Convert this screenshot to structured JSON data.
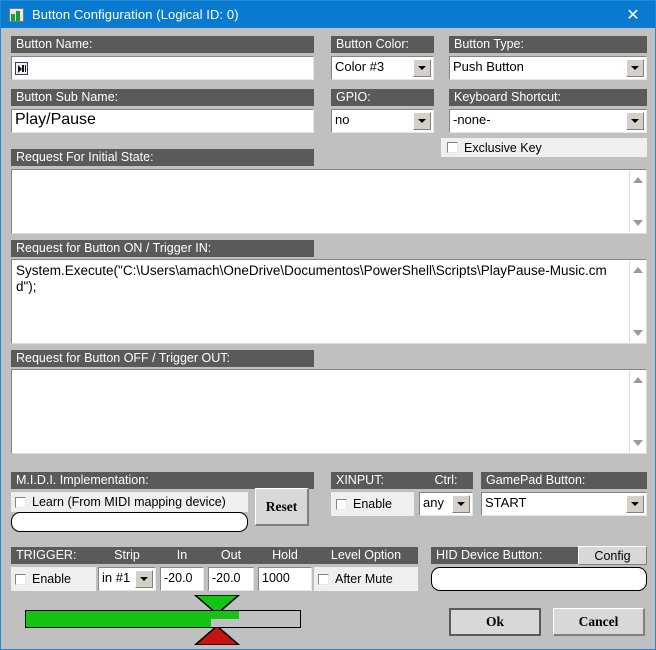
{
  "window": {
    "title": "Button Configuration (Logical ID: 0)",
    "close_label": "✕",
    "app_icon": "app-window-icon",
    "titlebar_color": "#0a7ad0",
    "label_bar_color": "#5a5a5a",
    "background_color": "#c0c0c0"
  },
  "button_name": {
    "label": "Button Name:",
    "value": "",
    "glyph": "play-pause-glyph"
  },
  "button_sub_name": {
    "label": "Button Sub Name:",
    "value": "Play/Pause"
  },
  "button_color": {
    "label": "Button Color:",
    "value": "Color #3"
  },
  "gpio": {
    "label": "GPIO:",
    "value": "no"
  },
  "button_type": {
    "label": "Button Type:",
    "value": "Push Button"
  },
  "keyboard_shortcut": {
    "label": "Keyboard Shortcut:",
    "value": "-none-"
  },
  "exclusive_key": {
    "label": "Exclusive Key",
    "checked": false
  },
  "initial_state": {
    "label": "Request For Initial State:",
    "value": ""
  },
  "button_on": {
    "label": "Request for Button ON / Trigger IN:",
    "value": "System.Execute(\"C:\\Users\\amach\\OneDrive\\Documentos\\PowerShell\\Scripts\\PlayPause-Music.cmd\");"
  },
  "button_off": {
    "label": "Request for Button OFF / Trigger OUT:",
    "value": ""
  },
  "midi": {
    "label": "M.I.D.I. Implementation:",
    "learn_label": "Learn (From MIDI mapping device)",
    "learn_checked": false,
    "mapping_value": "",
    "reset_label": "Reset"
  },
  "xinput": {
    "label": "XINPUT:",
    "enable_label": "Enable",
    "enable_checked": false,
    "ctrl_label": "Ctrl:",
    "ctrl_value": "any",
    "gamepad_label": "GamePad Button:",
    "gamepad_value": "START"
  },
  "trigger": {
    "label": "TRIGGER:",
    "enable_label": "Enable",
    "enable_checked": false,
    "strip_label": "Strip",
    "strip_value": "in #1",
    "in_label": "In",
    "in_value": "-20.0",
    "out_label": "Out",
    "out_value": "-20.0",
    "hold_label": "Hold",
    "hold_value": "1000",
    "level_option_label": "Level Option",
    "after_mute_label": "After Mute",
    "after_mute_checked": false
  },
  "hid": {
    "label": "HID Device Button:",
    "config_label": "Config",
    "value": ""
  },
  "actions": {
    "ok_label": "Ok",
    "cancel_label": "Cancel"
  },
  "meter": {
    "fill_color": "#13c413",
    "marker_top_color": "#13c413",
    "marker_bottom_color": "#c41414",
    "level_percent": 67,
    "peak_percent": 77,
    "marker_percent": 69
  }
}
